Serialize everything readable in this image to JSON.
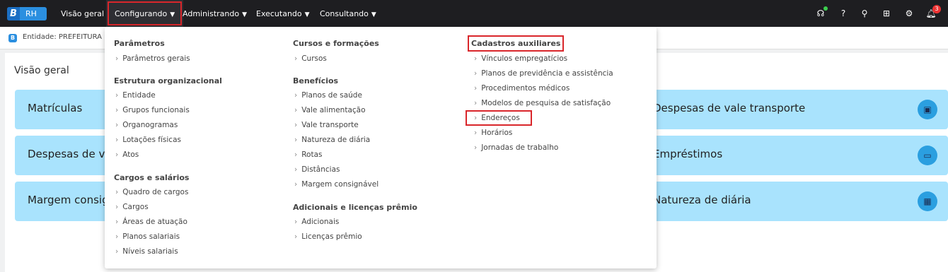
{
  "app": {
    "logo_letter": "B",
    "logo_text": "RH"
  },
  "nav": {
    "items": [
      "Visão geral",
      "Configurando",
      "Administrando",
      "Executando",
      "Consultando"
    ],
    "active_index": 1,
    "notification_count": "3"
  },
  "entity": {
    "label": "Entidade: PREFEITURA D"
  },
  "page": {
    "title": "Visão geral"
  },
  "cards": [
    {
      "label": "Matrículas"
    },
    {
      "label": "Despesas de val"
    },
    {
      "label": "Margem consign"
    },
    {
      "label": "Despesas de vale transporte",
      "icon": "bus-icon"
    },
    {
      "label": "Empréstimos",
      "icon": "cash-icon"
    },
    {
      "label": "Natureza de diária",
      "icon": "building-icon"
    }
  ],
  "menu": {
    "col1": {
      "sections": [
        {
          "title": "Parâmetros",
          "items": [
            "Parâmetros gerais"
          ]
        },
        {
          "title": "Estrutura organizacional",
          "items": [
            "Entidade",
            "Grupos funcionais",
            "Organogramas",
            "Lotações físicas",
            "Atos"
          ]
        },
        {
          "title": "Cargos e salários",
          "items": [
            "Quadro de cargos",
            "Cargos",
            "Áreas de atuação",
            "Planos salariais",
            "Níveis salariais"
          ]
        }
      ]
    },
    "col2": {
      "sections": [
        {
          "title": "Cursos e formações",
          "items": [
            "Cursos"
          ]
        },
        {
          "title": "Benefícios",
          "items": [
            "Planos de saúde",
            "Vale alimentação",
            "Vale transporte",
            "Natureza de diária",
            "Rotas",
            "Distâncias",
            "Margem consignável"
          ]
        },
        {
          "title": "Adicionais e licenças prêmio",
          "items": [
            "Adicionais",
            "Licenças prêmio"
          ]
        }
      ]
    },
    "col3": {
      "sections": [
        {
          "title": "Cadastros auxiliares",
          "items": [
            "Vínculos empregatícios",
            "Planos de previdência e assistência",
            "Procedimentos médicos",
            "Modelos de pesquisa de satisfação",
            "Endereços",
            "Horários",
            "Jornadas de trabalho"
          ]
        }
      ]
    }
  },
  "highlight_color": "#d9262b"
}
